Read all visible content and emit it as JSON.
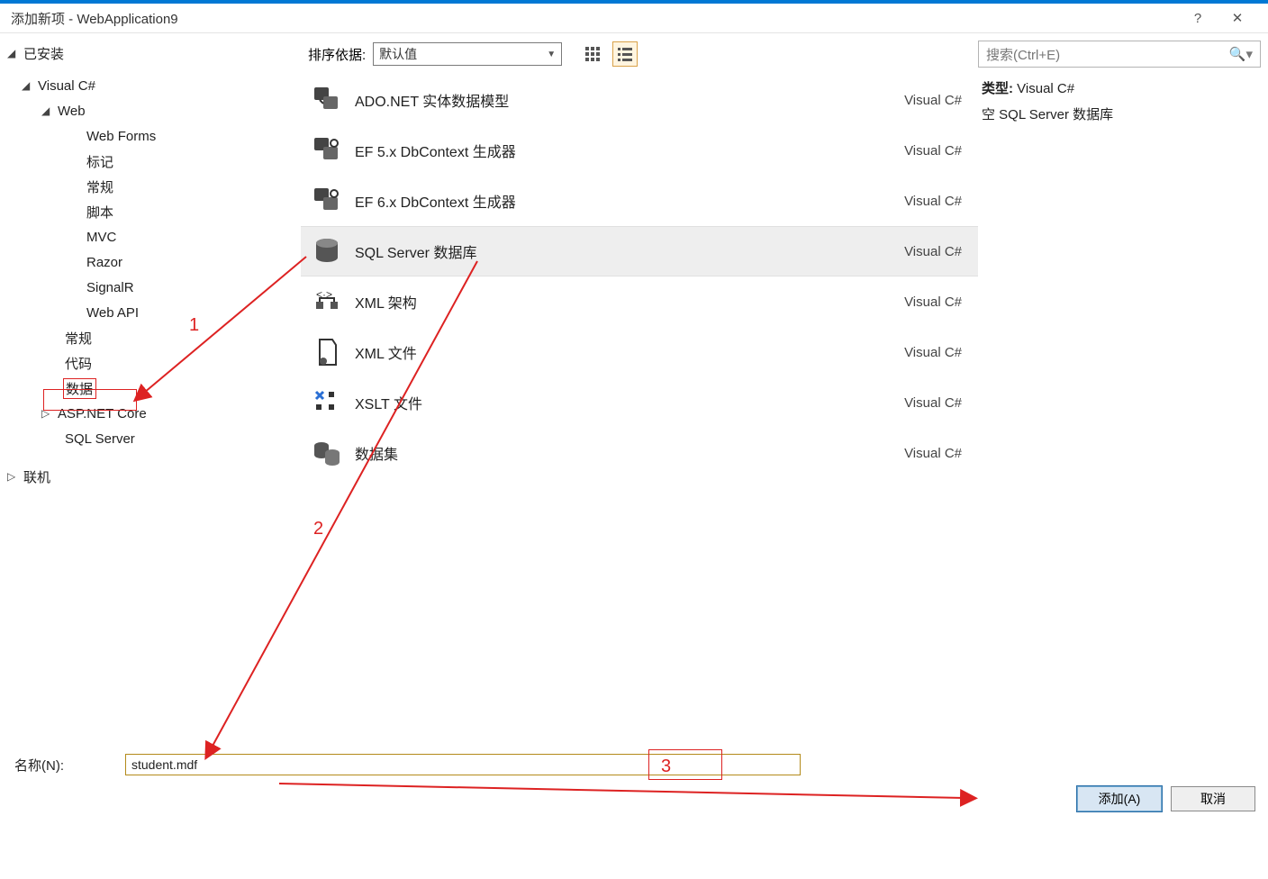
{
  "window": {
    "title": "添加新项 - WebApplication9"
  },
  "tree": {
    "installed": "已安装",
    "csharp": "Visual C#",
    "web": "Web",
    "webforms": "Web Forms",
    "biaoji": "标记",
    "changgui": "常规",
    "jiaoben": "脚本",
    "mvc": "MVC",
    "razor": "Razor",
    "signalr": "SignalR",
    "webapi": "Web API",
    "changgui2": "常规",
    "daima": "代码",
    "shuju": "数据",
    "aspnetcore": "ASP.NET Core",
    "sqlserver": "SQL Server",
    "online": "联机"
  },
  "toolbar": {
    "sort_label": "排序依据:",
    "sort_value": "默认值"
  },
  "items": [
    {
      "name": "ADO.NET 实体数据模型",
      "lang": "Visual C#"
    },
    {
      "name": "EF 5.x DbContext 生成器",
      "lang": "Visual C#"
    },
    {
      "name": "EF 6.x DbContext 生成器",
      "lang": "Visual C#"
    },
    {
      "name": "SQL Server 数据库",
      "lang": "Visual C#"
    },
    {
      "name": "XML 架构",
      "lang": "Visual C#"
    },
    {
      "name": "XML 文件",
      "lang": "Visual C#"
    },
    {
      "name": "XSLT 文件",
      "lang": "Visual C#"
    },
    {
      "name": "数据集",
      "lang": "Visual C#"
    }
  ],
  "search": {
    "placeholder": "搜索(Ctrl+E)"
  },
  "desc": {
    "type_label": "类型:",
    "type_value": "Visual C#",
    "text": "空 SQL Server 数据库"
  },
  "bottom": {
    "name_label": "名称(N):",
    "name_value": "student.mdf"
  },
  "buttons": {
    "add": "添加(A)",
    "cancel": "取消"
  },
  "anno": {
    "n1": "1",
    "n2": "2",
    "n3": "3"
  }
}
